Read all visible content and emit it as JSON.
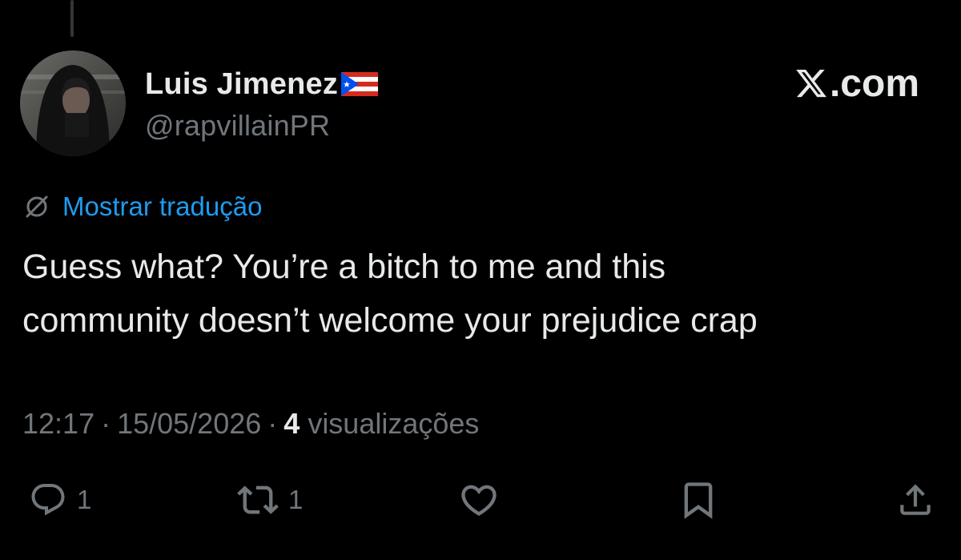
{
  "author": {
    "display_name": "Luis Jimenez",
    "handle": "@rapvillainPR",
    "flag_icon": "puerto-rico-flag-icon"
  },
  "brand": {
    "label": ".com",
    "logo_icon": "x-logo-icon"
  },
  "translate": {
    "label": "Mostrar tradução",
    "icon": "globe-slash-icon",
    "link_color": "#1d9bf0"
  },
  "tweet": {
    "text": "Guess what? You’re a bitch to me and this\ncommunity doesn’t welcome your prejudice crap"
  },
  "meta": {
    "time": "12:17",
    "separator": "·",
    "date": "15/05/2026",
    "views_count": "4",
    "views_label": "visualizações"
  },
  "actions": {
    "reply": {
      "icon": "reply-icon",
      "count": "1"
    },
    "repost": {
      "icon": "repost-icon",
      "count": "1"
    },
    "like": {
      "icon": "heart-icon"
    },
    "bookmark": {
      "icon": "bookmark-icon"
    },
    "share": {
      "icon": "share-icon"
    }
  },
  "colors": {
    "background": "#000000",
    "text_primary": "#e7e9ea",
    "text_secondary": "#71767b",
    "accent": "#1d9bf0"
  }
}
